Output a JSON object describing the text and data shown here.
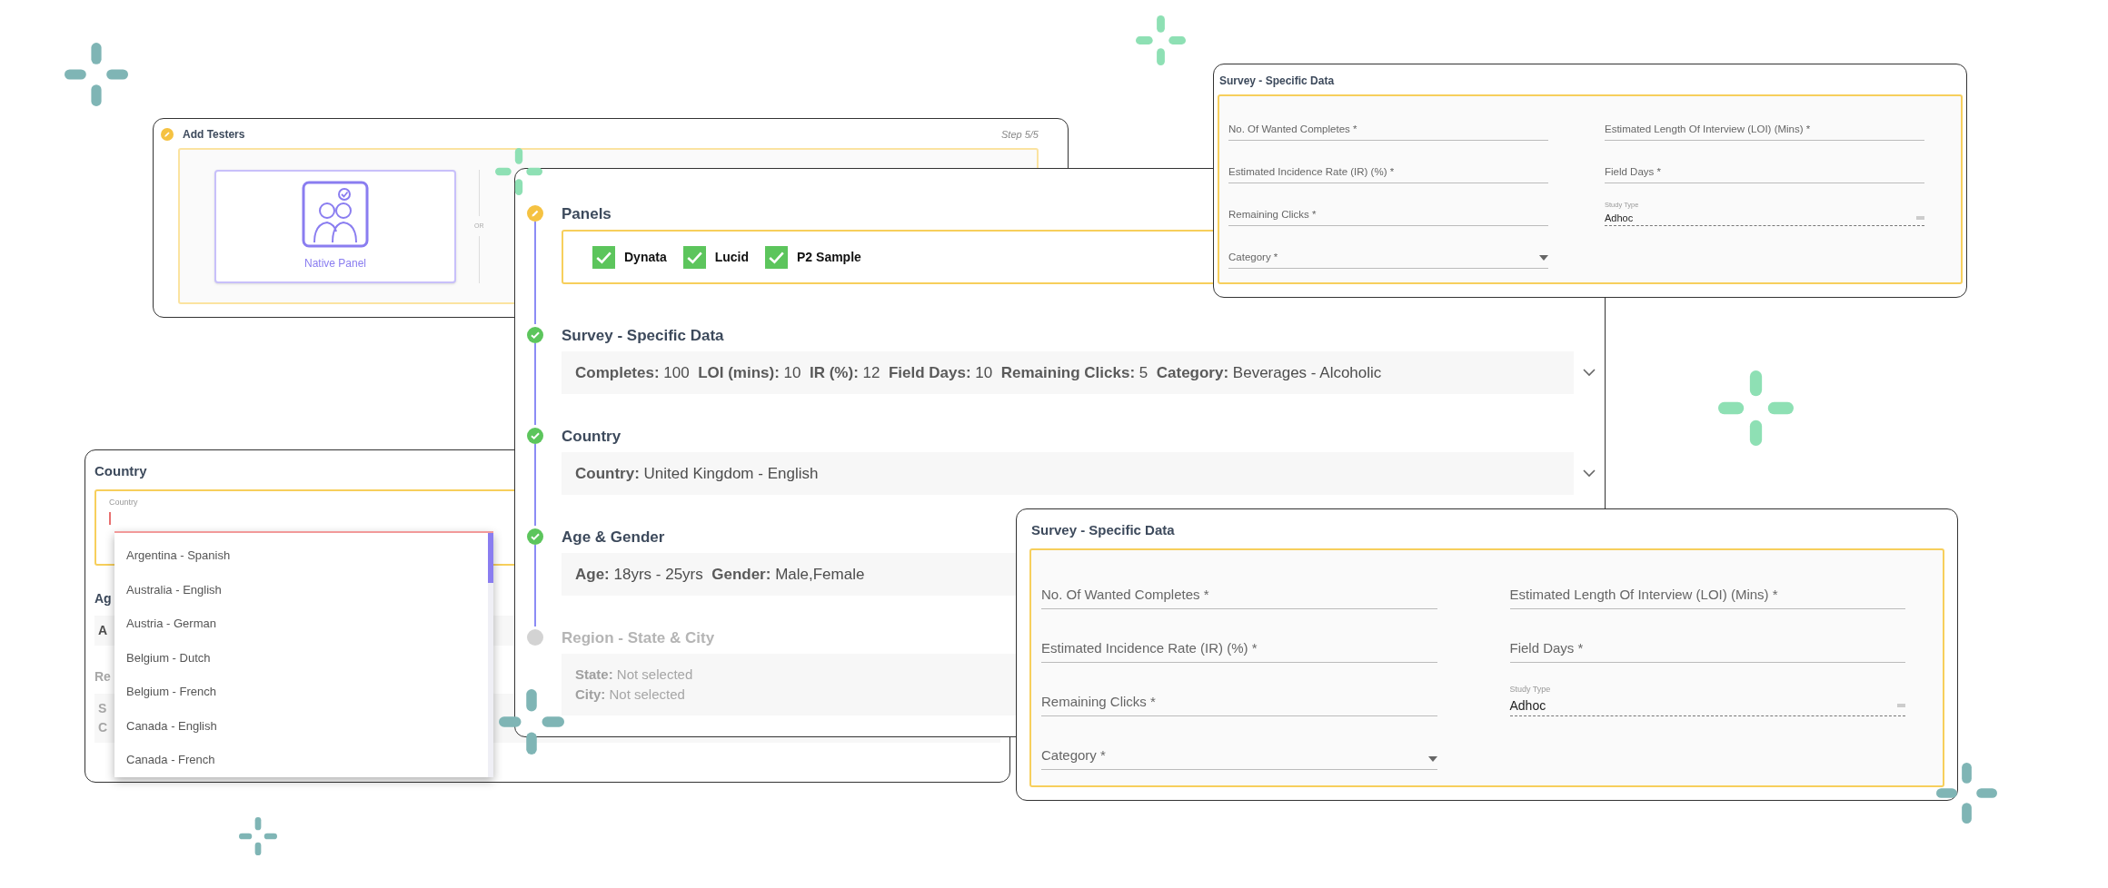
{
  "add_testers_card": {
    "title": "Add Testers",
    "step": "Step 5/5",
    "options": [
      {
        "label": "Native Panel",
        "selected": true
      }
    ],
    "divider": "OR"
  },
  "country_card": {
    "title": "Country",
    "field": {
      "label": "Country"
    },
    "dropdown": [
      {
        "label": "Argentina - Spanish"
      },
      {
        "label": "Australia - English"
      },
      {
        "label": "Austria - German"
      },
      {
        "label": "Belgium - Dutch"
      },
      {
        "label": "Belgium - French"
      },
      {
        "label": "Canada - English"
      },
      {
        "label": "Canada - French"
      }
    ],
    "hidden_sections": [
      {
        "title": "Ag",
        "disabled": false,
        "lines": [
          "A"
        ]
      },
      {
        "title": "Re",
        "disabled": true,
        "lines": [
          "S",
          "C"
        ]
      }
    ]
  },
  "main_card": {
    "steps": [
      {
        "title": "Panels",
        "completed": false,
        "disabled": false,
        "panels": [
          {
            "label": "Dynata",
            "checked": true
          },
          {
            "label": "Lucid",
            "checked": true
          },
          {
            "label": "P2 Sample",
            "checked": true
          }
        ]
      },
      {
        "title": "Survey - Specific Data",
        "completed": true,
        "disabled": false,
        "expandable": true,
        "lines": [
          [
            {
              "key": "Completes:",
              "value": "100"
            },
            {
              "key": "LOI (mins):",
              "value": "10"
            },
            {
              "key": "IR (%):",
              "value": "12"
            },
            {
              "key": "Field Days:",
              "value": "10"
            },
            {
              "key": "Remaining Clicks:",
              "value": "5"
            },
            {
              "key": "Category:",
              "value": "Beverages - Alcoholic"
            }
          ]
        ]
      },
      {
        "title": "Country",
        "completed": true,
        "disabled": false,
        "expandable": true,
        "lines": [
          [
            {
              "key": "Country:",
              "value": "United Kingdom - English"
            }
          ]
        ]
      },
      {
        "title": "Age & Gender",
        "completed": true,
        "disabled": false,
        "lines": [
          [
            {
              "key": "Age:",
              "value": "18yrs - 25yrs"
            },
            {
              "key": "Gender:",
              "value": "Male,Female"
            }
          ]
        ]
      },
      {
        "title": "Region - State & City",
        "completed": false,
        "disabled": true,
        "lines": [
          [
            {
              "key": "State:",
              "value": "Not selected"
            }
          ],
          [
            {
              "key": "City:",
              "value": "Not selected"
            }
          ]
        ]
      }
    ]
  },
  "survey_cards": [
    {
      "title": "Survey - Specific Data",
      "rows": [
        [
          {
            "kind": "text",
            "label": "No. Of Wanted Completes *"
          },
          {
            "kind": "text",
            "label": "Estimated Length Of Interview (LOI) (Mins) *"
          }
        ],
        [
          {
            "kind": "text",
            "label": "Estimated Incidence Rate (IR) (%) *"
          },
          {
            "kind": "text",
            "label": "Field Days *"
          }
        ],
        [
          {
            "kind": "text",
            "label": "Remaining Clicks *"
          },
          {
            "kind": "readonly",
            "label": "Study Type",
            "value": "Adhoc"
          }
        ],
        [
          {
            "kind": "select",
            "label": "Category *"
          }
        ]
      ]
    },
    {
      "title": "Survey - Specific Data",
      "rows": [
        [
          {
            "kind": "text",
            "label": "No. Of Wanted Completes *"
          },
          {
            "kind": "text",
            "label": "Estimated Length Of Interview (LOI) (Mins) *"
          }
        ],
        [
          {
            "kind": "text",
            "label": "Estimated Incidence Rate (IR) (%) *"
          },
          {
            "kind": "text",
            "label": "Field Days *"
          }
        ],
        [
          {
            "kind": "text",
            "label": "Remaining Clicks *"
          },
          {
            "kind": "readonly",
            "label": "Study Type",
            "value": "Adhoc"
          }
        ],
        [
          {
            "kind": "select",
            "label": "Category *"
          }
        ]
      ]
    }
  ]
}
